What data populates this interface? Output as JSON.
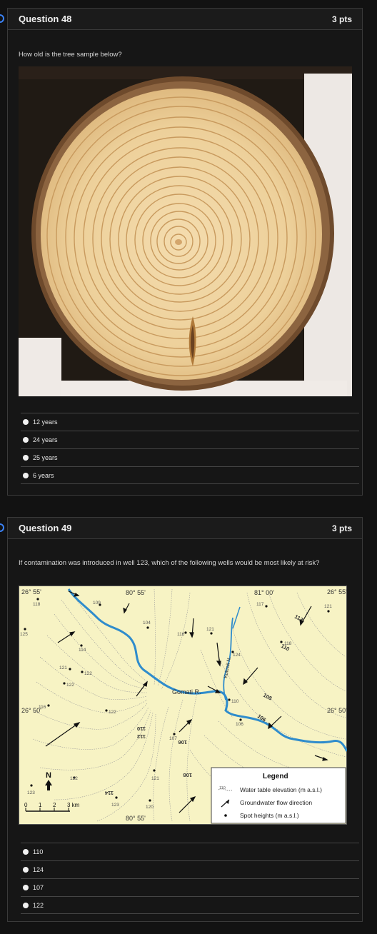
{
  "q48": {
    "title": "Question 48",
    "points": "3 pts",
    "prompt": "How old is the tree sample below?",
    "answers": [
      "12 years",
      "24 years",
      "25 years",
      "6 years"
    ]
  },
  "q49": {
    "title": "Question 49",
    "points": "3 pts",
    "prompt": "If contamination was introduced in well 123, which of the following wells would be most likely at risk?",
    "answers": [
      "110",
      "124",
      "107",
      "122"
    ]
  },
  "map": {
    "lat_top": "26° 55'",
    "lat_mid": "26° 50'",
    "lon_left": "80° 55'",
    "lon_right": "81° 00'",
    "lon_bottom": "80° 55'",
    "river_gomati": "Gomati R.",
    "river_kukrail": "Kukrail N.",
    "north": "N",
    "scale_ticks": [
      "0",
      "1",
      "2",
      "3 km"
    ],
    "legend_title": "Legend",
    "legend_items": [
      "Water table elevation (m a.s.l.)",
      "Groundwater flow direction",
      "Spot heights (m a.s.l.)"
    ],
    "legend_sample": "110",
    "spot_heights": [
      "118",
      "109",
      "104",
      "117",
      "121",
      "125",
      "114",
      "116",
      "121",
      "118",
      "121",
      "122",
      "122",
      "116",
      "122",
      "124",
      "110",
      "107",
      "106",
      "122",
      "121",
      "123",
      "123",
      "120",
      "121"
    ],
    "contours": [
      "110",
      "112",
      "106",
      "108",
      "114",
      "112",
      "110",
      "108",
      "106"
    ]
  },
  "colors": {
    "accent": "#3b82f6",
    "map_bg": "#f7f3c4",
    "river": "#2f8ccc"
  }
}
